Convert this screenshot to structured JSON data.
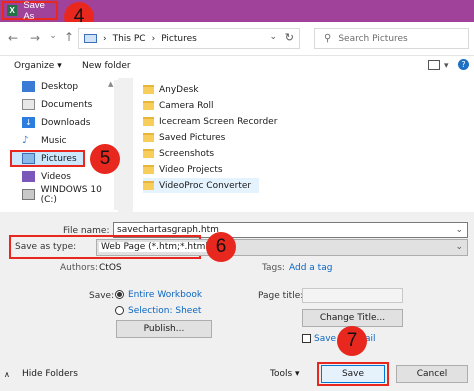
{
  "window": {
    "title": "Save As"
  },
  "badges": {
    "b4": "4",
    "b5": "5",
    "b6": "6",
    "b7": "7"
  },
  "address": {
    "path_root": "This PC",
    "path_sep": "›",
    "path_folder": "Pictures",
    "search_placeholder": "Search Pictures"
  },
  "toolbar": {
    "organize": "Organize",
    "new_folder": "New folder"
  },
  "nav": {
    "items": [
      {
        "label": "Desktop",
        "icon": "desktop-icon"
      },
      {
        "label": "Documents",
        "icon": "documents-icon"
      },
      {
        "label": "Downloads",
        "icon": "downloads-icon"
      },
      {
        "label": "Music",
        "icon": "music-icon"
      },
      {
        "label": "Pictures",
        "icon": "pictures-icon"
      },
      {
        "label": "Videos",
        "icon": "videos-icon"
      },
      {
        "label": "WINDOWS 10 (C:)",
        "icon": "drive-icon"
      }
    ]
  },
  "files": [
    "AnyDesk",
    "Camera Roll",
    "Icecream Screen Recorder",
    "Saved Pictures",
    "Screenshots",
    "Video Projects",
    "VideoProc Converter"
  ],
  "form": {
    "file_name_label": "File name:",
    "file_name_value": "savechartasgraph.htm",
    "save_type_label": "Save as type:",
    "save_type_value": "Web Page (*.htm;*.html)",
    "authors_label": "Authors:",
    "authors_value": "CtOS",
    "tags_label": "Tags:",
    "tags_value": "Add a tag",
    "save_label": "Save:",
    "opt_workbook": "Entire Workbook",
    "opt_selection": "Selection: Sheet",
    "publish": "Publish...",
    "page_title_label": "Page title:",
    "change_title": "Change Title...",
    "save_thumb": "Save Th",
    "save_thumb_end": "ail"
  },
  "footer": {
    "hide_folders": "Hide Folders",
    "tools": "Tools",
    "save": "Save",
    "cancel": "Cancel"
  },
  "colors": {
    "accent_title": "#a0429a",
    "callout": "#e8281e",
    "link": "#0b66c2"
  }
}
